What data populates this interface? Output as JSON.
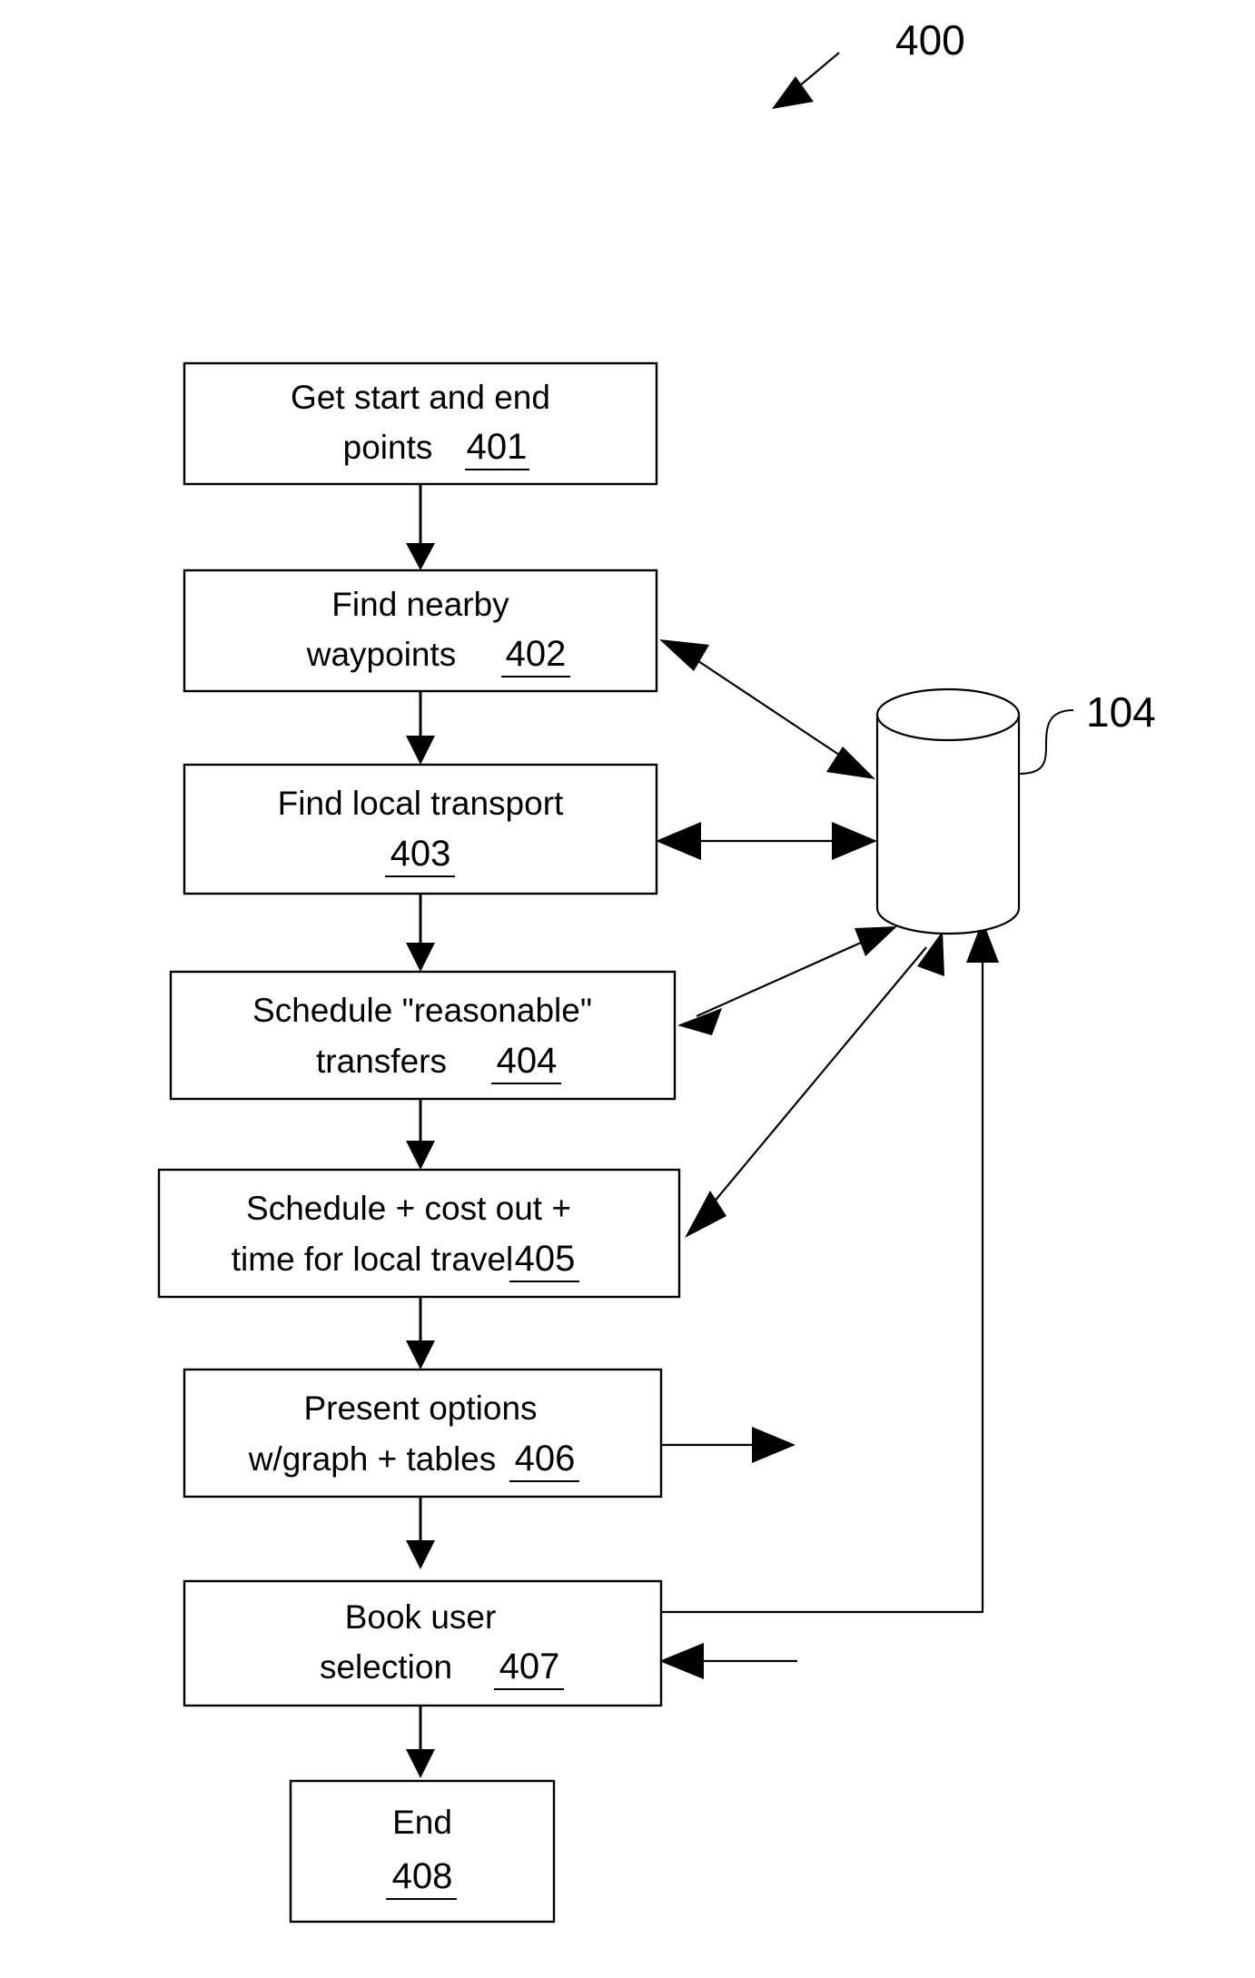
{
  "figure": {
    "label": "400",
    "database_label": "104"
  },
  "boxes": [
    {
      "id": "401",
      "lines": [
        "Get start and end",
        "points"
      ],
      "ref": "401",
      "name": "get-start-and-end-points"
    },
    {
      "id": "402",
      "lines": [
        "Find nearby",
        "waypoints"
      ],
      "ref": "402",
      "name": "find-nearby-waypoints"
    },
    {
      "id": "403",
      "lines": [
        "Find local transport",
        ""
      ],
      "ref": "403",
      "name": "find-local-transport"
    },
    {
      "id": "404",
      "lines": [
        "Schedule \"reasonable\"",
        "transfers"
      ],
      "ref": "404",
      "name": "schedule-reasonable-transfers"
    },
    {
      "id": "405",
      "lines": [
        "Schedule + cost out +",
        "time for local travel"
      ],
      "ref": "405",
      "name": "schedule-cost-out-time-for-local-travel"
    },
    {
      "id": "406",
      "lines": [
        "Present options",
        "w/graph + tables"
      ],
      "ref": "406",
      "name": "present-options-with-graph-and-tables"
    },
    {
      "id": "407",
      "lines": [
        "Book user",
        "selection"
      ],
      "ref": "407",
      "name": "book-user-selection"
    },
    {
      "id": "408",
      "lines": [
        "End",
        ""
      ],
      "ref": "408",
      "name": "end"
    }
  ],
  "box_text": {
    "b401_l1": "Get start and end",
    "b401_l2": "points",
    "b401_ref": "401",
    "b402_l1": "Find nearby",
    "b402_l2": "waypoints",
    "b402_ref": "402",
    "b403_l1": "Find local transport",
    "b403_ref": "403",
    "b404_l1": "Schedule \"reasonable\"",
    "b404_l2": "transfers",
    "b404_ref": "404",
    "b405_l1": "Schedule + cost out +",
    "b405_l2": "time for local travel",
    "b405_ref": "405",
    "b406_l1": "Present options",
    "b406_l2": "w/graph + tables",
    "b406_ref": "406",
    "b407_l1": "Book user",
    "b407_l2": "selection",
    "b407_ref": "407",
    "b408_l1": "End",
    "b408_ref": "408"
  },
  "colors": {
    "stroke": "#000000",
    "fill": "#ffffff",
    "background": "#ffffff"
  }
}
